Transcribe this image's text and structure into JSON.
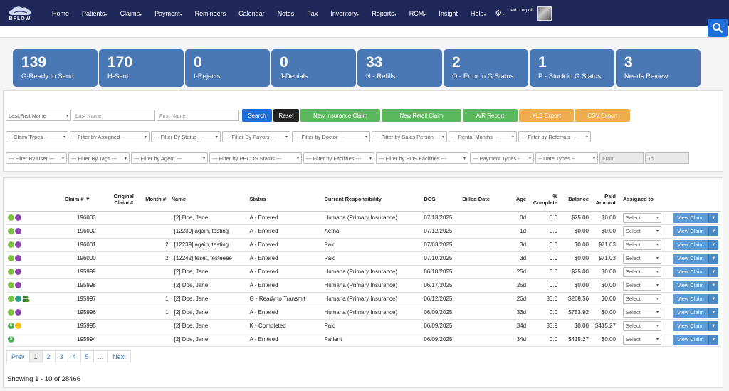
{
  "brand": {
    "name": "BFLOW",
    "accent": "#1f2858"
  },
  "nav": {
    "items": [
      {
        "label": "Home",
        "dropdown": false
      },
      {
        "label": "Patients",
        "dropdown": true
      },
      {
        "label": "Claims",
        "dropdown": true
      },
      {
        "label": "Payment",
        "dropdown": true
      },
      {
        "label": "Reminders",
        "dropdown": false
      },
      {
        "label": "Calendar",
        "dropdown": false
      },
      {
        "label": "Notes",
        "dropdown": false
      },
      {
        "label": "Fax",
        "dropdown": false
      },
      {
        "label": "Inventory",
        "dropdown": true
      },
      {
        "label": "Reports",
        "dropdown": true
      },
      {
        "label": "RCM",
        "dropdown": true
      },
      {
        "label": "Insight",
        "dropdown": false
      },
      {
        "label": "Help",
        "dropdown": true
      }
    ],
    "user": "ted",
    "logoff": "Log off"
  },
  "stats": [
    {
      "num": "139",
      "label": "G-Ready to Send"
    },
    {
      "num": "170",
      "label": "H-Sent"
    },
    {
      "num": "0",
      "label": "I-Rejects"
    },
    {
      "num": "0",
      "label": "J-Denials"
    },
    {
      "num": "33",
      "label": "N - Refills"
    },
    {
      "num": "2",
      "label": "O - Error in G Status"
    },
    {
      "num": "1",
      "label": "P - Stuck in G Status"
    },
    {
      "num": "3",
      "label": "Needs Review"
    }
  ],
  "filters": {
    "name_mode": "Last,First Name",
    "last_name_placeholder": "Last Name",
    "first_name_placeholder": "First Name",
    "search_label": "Search",
    "reset_label": "Reset",
    "new_insurance_claim": "New Insurance Claim",
    "new_retail_claim": "New Retail Claim",
    "ar_report": "A/R Report",
    "xls_export": "XLS Export",
    "csv_export": "CSV Export",
    "row2": [
      "-- Claim Types --",
      "-- Filter by Assigned --",
      "--- Filter By Status ---",
      "--- Filter By Payors ---",
      "--- Filter by Doctor ---",
      "--- Filter by Sales Person",
      "--- Rental Months ---",
      "--- Filter by Referrals ---"
    ],
    "row3": [
      "--- Filter By User ---",
      "--- Filter By Tags ---",
      "--- Filter by Agent ---",
      "--- Filter by PECOS Status ---",
      "--- Filter by Facilities ---",
      "--- Filter by POS Facilities ---",
      "--- Payment Types -",
      "-- Date Types --"
    ],
    "from_placeholder": "From",
    "to_placeholder": "To"
  },
  "table": {
    "headers": {
      "claim": "Claim #",
      "original": "Original Claim #",
      "month": "Month #",
      "name": "Name",
      "status": "Status",
      "responsibility": "Current Responsibility",
      "dos": "DOS",
      "billed": "Billed Date",
      "age": "Age",
      "complete": "% Complete",
      "balance": "Balance",
      "paid": "Paid Amount",
      "assigned": "Assigned to"
    },
    "select_label": "Select",
    "view_label": "View Claim",
    "rows": [
      {
        "icons": [
          "green",
          "purple"
        ],
        "claim": "196003",
        "original": "",
        "month": "",
        "name": "[2] Doe, Jane",
        "status": "A - Entered",
        "resp": "Humana (Primary Insurance)",
        "dos": "07/13/2025",
        "billed": "",
        "age": "0d",
        "complete": "0.0",
        "balance": "$25.00",
        "paid": "$0.00"
      },
      {
        "icons": [
          "green",
          "purple"
        ],
        "claim": "196002",
        "original": "",
        "month": "",
        "name": "[12239] again, testing",
        "status": "A - Entered",
        "resp": "Aetna",
        "dos": "07/12/2025",
        "billed": "",
        "age": "1d",
        "complete": "0.0",
        "balance": "$0.00",
        "paid": "$0.00"
      },
      {
        "icons": [
          "green",
          "purple"
        ],
        "claim": "196001",
        "original": "",
        "month": "2",
        "name": "[12239] again, testing",
        "status": "A - Entered",
        "resp": "Paid",
        "dos": "07/03/2025",
        "billed": "",
        "age": "3d",
        "complete": "0.0",
        "balance": "$0.00",
        "paid": "$71.03"
      },
      {
        "icons": [
          "green",
          "purple"
        ],
        "claim": "196000",
        "original": "",
        "month": "2",
        "name": "[12242] teset, testeeee",
        "status": "A - Entered",
        "resp": "Paid",
        "dos": "07/10/2025",
        "billed": "",
        "age": "3d",
        "complete": "0.0",
        "balance": "$0.00",
        "paid": "$71.03"
      },
      {
        "icons": [
          "green",
          "purple"
        ],
        "claim": "195999",
        "original": "",
        "month": "",
        "name": "[2] Doe, Jane",
        "status": "A - Entered",
        "resp": "Humana (Primary Insurance)",
        "dos": "06/18/2025",
        "billed": "",
        "age": "25d",
        "complete": "0.0",
        "balance": "$25.00",
        "paid": "$0.00"
      },
      {
        "icons": [
          "green",
          "purple"
        ],
        "claim": "195998",
        "original": "",
        "month": "",
        "name": "[2] Doe, Jane",
        "status": "A - Entered",
        "resp": "Humana (Primary Insurance)",
        "dos": "06/17/2025",
        "billed": "",
        "age": "25d",
        "complete": "0.0",
        "balance": "$0.00",
        "paid": "$0.00"
      },
      {
        "icons": [
          "green",
          "teal",
          "people"
        ],
        "claim": "195997",
        "original": "",
        "month": "1",
        "name": "[2] Doe, Jane",
        "status": "G - Ready to Transmit",
        "resp": "Humana (Primary Insurance)",
        "dos": "06/12/2025",
        "billed": "",
        "age": "26d",
        "complete": "80.6",
        "balance": "$268.56",
        "paid": "$0.00"
      },
      {
        "icons": [
          "green",
          "purple"
        ],
        "claim": "195996",
        "original": "",
        "month": "1",
        "name": "[2] Doe, Jane",
        "status": "A - Entered",
        "resp": "Humana (Primary Insurance)",
        "dos": "06/09/2025",
        "billed": "",
        "age": "33d",
        "complete": "0.0",
        "balance": "$753.92",
        "paid": "$0.00"
      },
      {
        "icons": [
          "dollar",
          "yellow"
        ],
        "claim": "195995",
        "original": "",
        "month": "",
        "name": "[2] Doe, Jane",
        "status": "K - Completed",
        "resp": "Paid",
        "dos": "06/09/2025",
        "billed": "",
        "age": "34d",
        "complete": "83.9",
        "balance": "$0.00",
        "paid": "$415.27"
      },
      {
        "icons": [
          "dollar"
        ],
        "claim": "195994",
        "original": "",
        "month": "",
        "name": "[2] Doe, Jane",
        "status": "A - Entered",
        "resp": "Patient",
        "dos": "06/09/2025",
        "billed": "",
        "age": "34d",
        "complete": "0.0",
        "balance": "$415.27",
        "paid": "$0.00"
      }
    ]
  },
  "pagination": {
    "prev": "Prev",
    "pages": [
      "1",
      "2",
      "3",
      "4",
      "5",
      "..."
    ],
    "next": "Next",
    "active": "1"
  },
  "showing": "Showing 1 - 10 of 28466"
}
